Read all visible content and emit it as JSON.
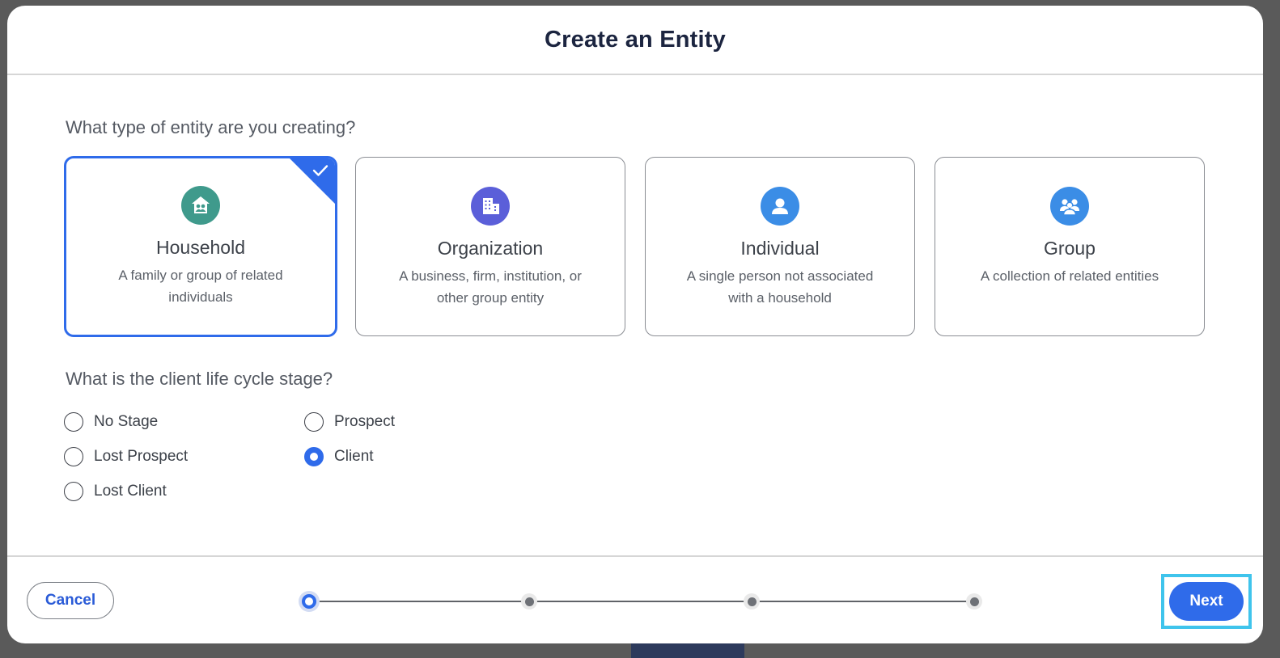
{
  "modal": {
    "title": "Create an Entity"
  },
  "entity_type": {
    "question": "What type of entity are you creating?",
    "selected": "Household",
    "cards": [
      {
        "title": "Household",
        "desc": "A family or group of related individuals",
        "icon": "household-icon",
        "color": "#3f9a8c"
      },
      {
        "title": "Organization",
        "desc": "A business, firm, institution, or other group entity",
        "icon": "building-icon",
        "color": "#5b5fd9"
      },
      {
        "title": "Individual",
        "desc": "A single person not associated with a household",
        "icon": "person-icon",
        "color": "#3b8de6"
      },
      {
        "title": "Group",
        "desc": "A collection of related entities",
        "icon": "people-group-icon",
        "color": "#3b8de6"
      }
    ]
  },
  "life_cycle": {
    "question": "What is the client life cycle stage?",
    "selected": "Client",
    "options": [
      "No Stage",
      "Lost Prospect",
      "Lost Client",
      "Prospect",
      "Client"
    ]
  },
  "footer": {
    "cancel_label": "Cancel",
    "next_label": "Next",
    "steps_total": 4,
    "current_step": 1
  },
  "colors": {
    "accent": "#2f6bea",
    "focus_ring": "#3fc4ec"
  }
}
